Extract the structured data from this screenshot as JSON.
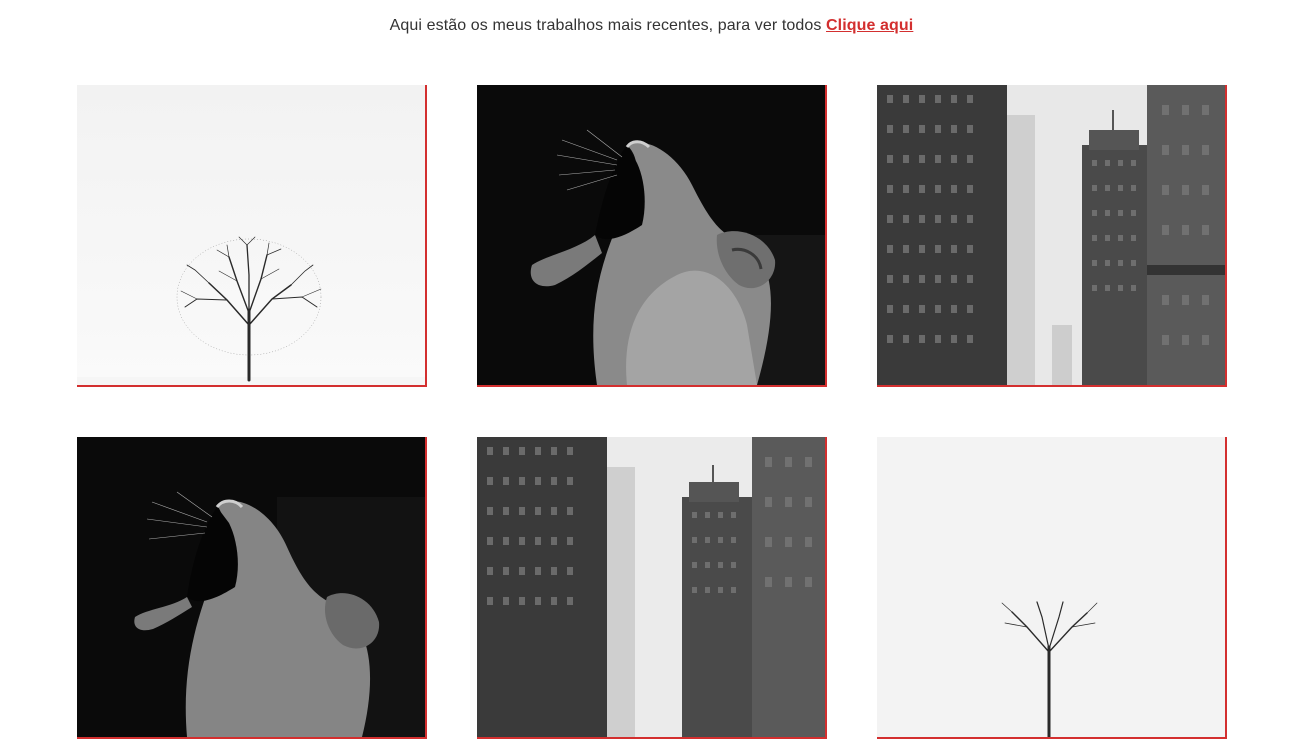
{
  "intro": {
    "text": "Aqui estão os meus trabalhos mais recentes, para ver todos",
    "link_label": "Clique aqui"
  },
  "colors": {
    "accent": "#d32f2f",
    "text": "#333333",
    "background": "#ffffff"
  },
  "gallery": {
    "items": [
      {
        "subject": "lone-tree"
      },
      {
        "subject": "lioness-yawning"
      },
      {
        "subject": "city-skyscrapers"
      },
      {
        "subject": "lioness-yawning"
      },
      {
        "subject": "city-skyscrapers"
      },
      {
        "subject": "lone-tree"
      }
    ]
  }
}
